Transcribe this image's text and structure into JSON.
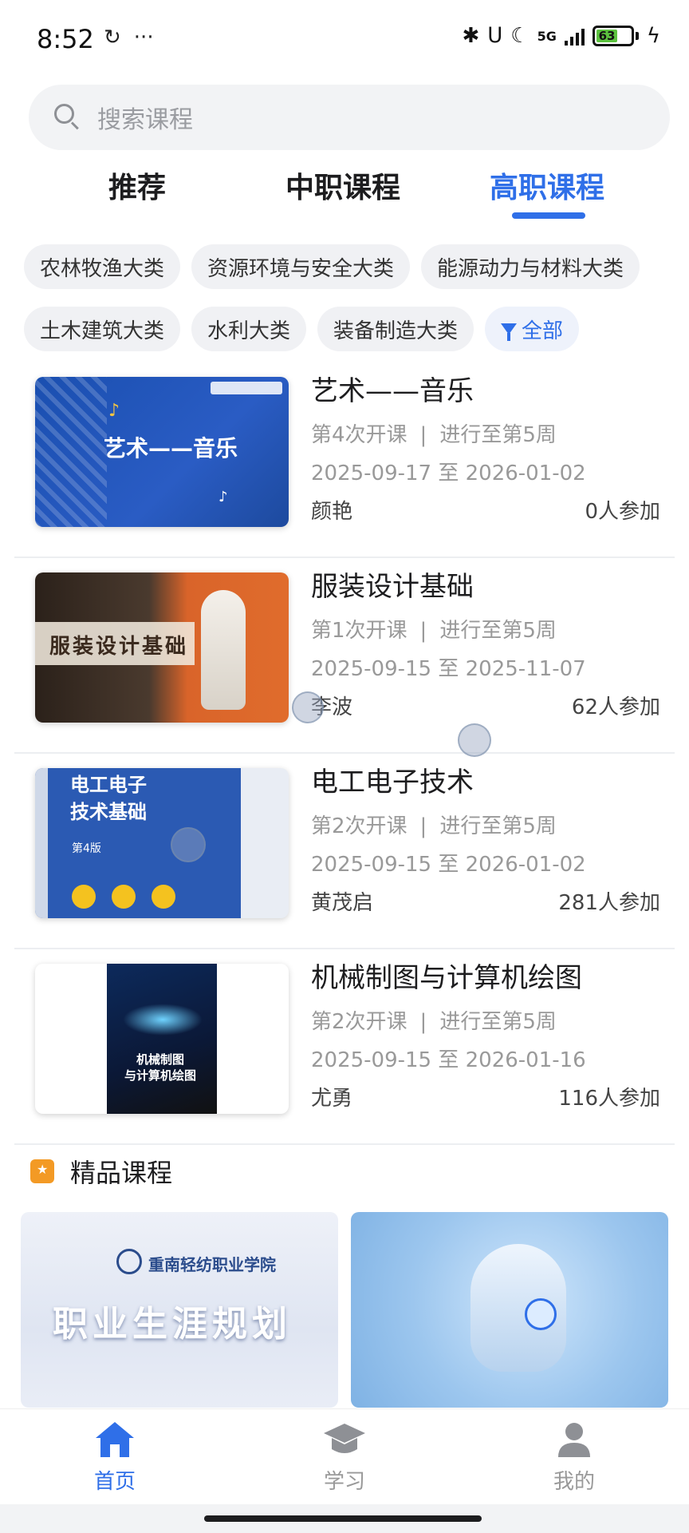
{
  "status_bar": {
    "time": "8:52",
    "network": "5G",
    "battery": "63"
  },
  "search": {
    "placeholder": "搜索课程"
  },
  "tabs": [
    {
      "label": "推荐"
    },
    {
      "label": "中职课程"
    },
    {
      "label": "高职课程",
      "active": true
    }
  ],
  "categories": {
    "row1": [
      "农林牧渔大类",
      "资源环境与安全大类",
      "能源动力与材料大类"
    ],
    "row2": [
      "土木建筑大类",
      "水利大类",
      "装备制造大类"
    ],
    "all_label": "全部"
  },
  "courses": [
    {
      "title": "艺术——音乐",
      "session": "第4次开课",
      "progress": "进行至第5周",
      "dates": "2025-09-17 至 2026-01-02",
      "teacher": "颜艳",
      "participants": "0人参加",
      "thumb_text": "艺术——音乐"
    },
    {
      "title": "服装设计基础",
      "session": "第1次开课",
      "progress": "进行至第5周",
      "dates": "2025-09-15 至 2025-11-07",
      "teacher": "李波",
      "participants": "62人参加",
      "thumb_text": "服装设计基础"
    },
    {
      "title": "电工电子技术",
      "session": "第2次开课",
      "progress": "进行至第5周",
      "dates": "2025-09-15 至 2026-01-02",
      "teacher": "黄茂启",
      "participants": "281人参加",
      "thumb_text": "电工电子\n技术基础",
      "thumb_sub": "第4版"
    },
    {
      "title": "机械制图与计算机绘图",
      "session": "第2次开课",
      "progress": "进行至第5周",
      "dates": "2025-09-15 至 2026-01-16",
      "teacher": "尤勇",
      "participants": "116人参加",
      "thumb_text": "机械制图\n与计算机绘图"
    }
  ],
  "quality": {
    "title": "精品课程",
    "cards": [
      {
        "thumb_text": "职业生涯规划",
        "logo_text": "重南轻纺职业学院"
      },
      {
        "thumb_text": ""
      }
    ]
  },
  "nav": [
    {
      "label": "首页",
      "icon": "home-icon",
      "active": true
    },
    {
      "label": "学习",
      "icon": "graduation-cap-icon"
    },
    {
      "label": "我的",
      "icon": "user-icon"
    }
  ],
  "colors": {
    "accent": "#2f6fe8",
    "chip_bg": "#f0f1f4",
    "quality_icon": "#f39a25"
  }
}
